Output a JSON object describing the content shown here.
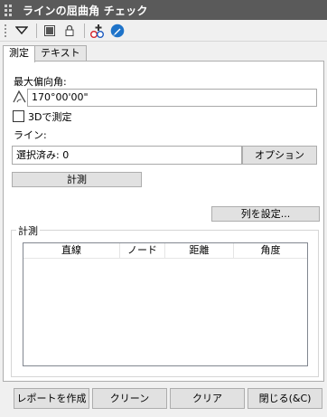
{
  "window": {
    "title": "ラインの屈曲角 チェック"
  },
  "toolbar": {
    "icons": [
      "dropdown-arrow-icon",
      "window-icon",
      "lock-icon",
      "add-shapes-icon",
      "pen-icon"
    ]
  },
  "tabs": [
    {
      "label": "測定",
      "active": true
    },
    {
      "label": "テキスト",
      "active": false
    }
  ],
  "measure": {
    "max_angle_label": "最大偏向角:",
    "max_angle_value": "170°00'00\"",
    "measure3d_label": "3Dで測定",
    "measure3d_checked": false,
    "line_label": "ライン:",
    "selected_value": "選択済み: 0",
    "options_button": "オプション",
    "measure_button": "計測",
    "set_columns_button": "列を設定...",
    "group_title": "計測",
    "columns": [
      "直線",
      "ノード",
      "距離",
      "角度"
    ]
  },
  "footer": {
    "report": "レポートを作成",
    "clean": "クリーン",
    "clear": "クリア",
    "close": "閉じる(&C)"
  }
}
